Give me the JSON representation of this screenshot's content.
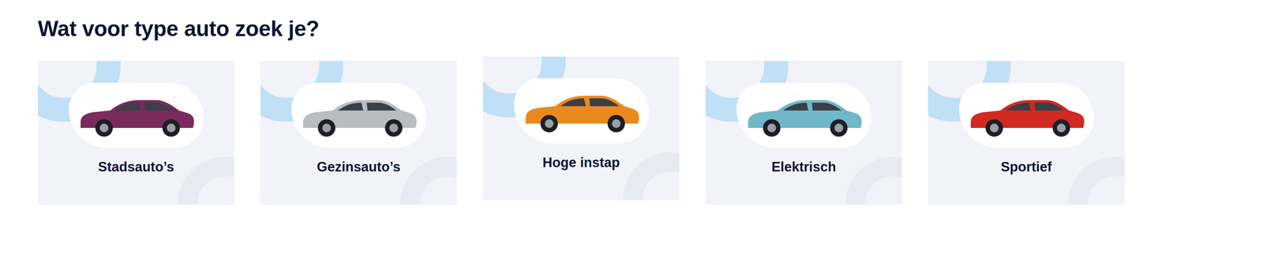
{
  "heading": "Wat voor type auto zoek je?",
  "categories": [
    {
      "label": "Stadsauto’s",
      "color": "#7a2a5c",
      "hovered": false
    },
    {
      "label": "Gezinsauto’s",
      "color": "#b9bcc1",
      "hovered": false
    },
    {
      "label": "Hoge instap",
      "color": "#e98a1f",
      "hovered": true
    },
    {
      "label": "Elektrisch",
      "color": "#6fb7c9",
      "hovered": false
    },
    {
      "label": "Sportief",
      "color": "#d02a22",
      "hovered": false
    }
  ]
}
